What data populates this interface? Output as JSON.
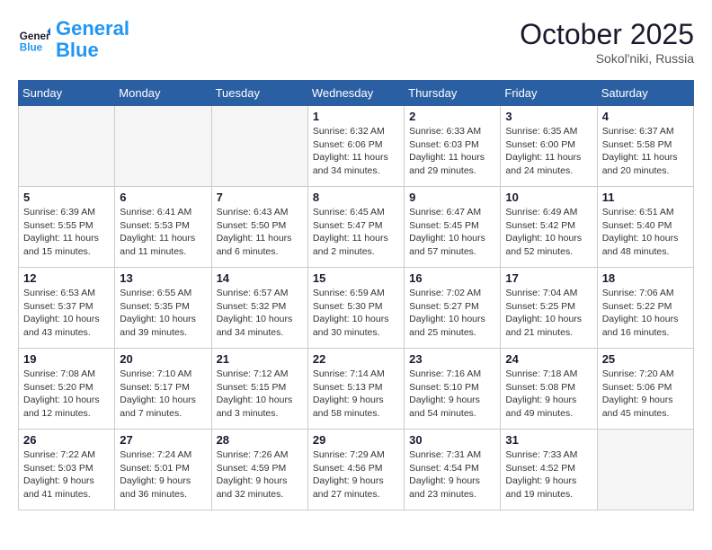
{
  "header": {
    "logo_line1": "General",
    "logo_line2": "Blue",
    "month": "October 2025",
    "location": "Sokol'niki, Russia"
  },
  "weekdays": [
    "Sunday",
    "Monday",
    "Tuesday",
    "Wednesday",
    "Thursday",
    "Friday",
    "Saturday"
  ],
  "weeks": [
    [
      {
        "day": "",
        "info": ""
      },
      {
        "day": "",
        "info": ""
      },
      {
        "day": "",
        "info": ""
      },
      {
        "day": "1",
        "info": "Sunrise: 6:32 AM\nSunset: 6:06 PM\nDaylight: 11 hours\nand 34 minutes."
      },
      {
        "day": "2",
        "info": "Sunrise: 6:33 AM\nSunset: 6:03 PM\nDaylight: 11 hours\nand 29 minutes."
      },
      {
        "day": "3",
        "info": "Sunrise: 6:35 AM\nSunset: 6:00 PM\nDaylight: 11 hours\nand 24 minutes."
      },
      {
        "day": "4",
        "info": "Sunrise: 6:37 AM\nSunset: 5:58 PM\nDaylight: 11 hours\nand 20 minutes."
      }
    ],
    [
      {
        "day": "5",
        "info": "Sunrise: 6:39 AM\nSunset: 5:55 PM\nDaylight: 11 hours\nand 15 minutes."
      },
      {
        "day": "6",
        "info": "Sunrise: 6:41 AM\nSunset: 5:53 PM\nDaylight: 11 hours\nand 11 minutes."
      },
      {
        "day": "7",
        "info": "Sunrise: 6:43 AM\nSunset: 5:50 PM\nDaylight: 11 hours\nand 6 minutes."
      },
      {
        "day": "8",
        "info": "Sunrise: 6:45 AM\nSunset: 5:47 PM\nDaylight: 11 hours\nand 2 minutes."
      },
      {
        "day": "9",
        "info": "Sunrise: 6:47 AM\nSunset: 5:45 PM\nDaylight: 10 hours\nand 57 minutes."
      },
      {
        "day": "10",
        "info": "Sunrise: 6:49 AM\nSunset: 5:42 PM\nDaylight: 10 hours\nand 52 minutes."
      },
      {
        "day": "11",
        "info": "Sunrise: 6:51 AM\nSunset: 5:40 PM\nDaylight: 10 hours\nand 48 minutes."
      }
    ],
    [
      {
        "day": "12",
        "info": "Sunrise: 6:53 AM\nSunset: 5:37 PM\nDaylight: 10 hours\nand 43 minutes."
      },
      {
        "day": "13",
        "info": "Sunrise: 6:55 AM\nSunset: 5:35 PM\nDaylight: 10 hours\nand 39 minutes."
      },
      {
        "day": "14",
        "info": "Sunrise: 6:57 AM\nSunset: 5:32 PM\nDaylight: 10 hours\nand 34 minutes."
      },
      {
        "day": "15",
        "info": "Sunrise: 6:59 AM\nSunset: 5:30 PM\nDaylight: 10 hours\nand 30 minutes."
      },
      {
        "day": "16",
        "info": "Sunrise: 7:02 AM\nSunset: 5:27 PM\nDaylight: 10 hours\nand 25 minutes."
      },
      {
        "day": "17",
        "info": "Sunrise: 7:04 AM\nSunset: 5:25 PM\nDaylight: 10 hours\nand 21 minutes."
      },
      {
        "day": "18",
        "info": "Sunrise: 7:06 AM\nSunset: 5:22 PM\nDaylight: 10 hours\nand 16 minutes."
      }
    ],
    [
      {
        "day": "19",
        "info": "Sunrise: 7:08 AM\nSunset: 5:20 PM\nDaylight: 10 hours\nand 12 minutes."
      },
      {
        "day": "20",
        "info": "Sunrise: 7:10 AM\nSunset: 5:17 PM\nDaylight: 10 hours\nand 7 minutes."
      },
      {
        "day": "21",
        "info": "Sunrise: 7:12 AM\nSunset: 5:15 PM\nDaylight: 10 hours\nand 3 minutes."
      },
      {
        "day": "22",
        "info": "Sunrise: 7:14 AM\nSunset: 5:13 PM\nDaylight: 9 hours\nand 58 minutes."
      },
      {
        "day": "23",
        "info": "Sunrise: 7:16 AM\nSunset: 5:10 PM\nDaylight: 9 hours\nand 54 minutes."
      },
      {
        "day": "24",
        "info": "Sunrise: 7:18 AM\nSunset: 5:08 PM\nDaylight: 9 hours\nand 49 minutes."
      },
      {
        "day": "25",
        "info": "Sunrise: 7:20 AM\nSunset: 5:06 PM\nDaylight: 9 hours\nand 45 minutes."
      }
    ],
    [
      {
        "day": "26",
        "info": "Sunrise: 7:22 AM\nSunset: 5:03 PM\nDaylight: 9 hours\nand 41 minutes."
      },
      {
        "day": "27",
        "info": "Sunrise: 7:24 AM\nSunset: 5:01 PM\nDaylight: 9 hours\nand 36 minutes."
      },
      {
        "day": "28",
        "info": "Sunrise: 7:26 AM\nSunset: 4:59 PM\nDaylight: 9 hours\nand 32 minutes."
      },
      {
        "day": "29",
        "info": "Sunrise: 7:29 AM\nSunset: 4:56 PM\nDaylight: 9 hours\nand 27 minutes."
      },
      {
        "day": "30",
        "info": "Sunrise: 7:31 AM\nSunset: 4:54 PM\nDaylight: 9 hours\nand 23 minutes."
      },
      {
        "day": "31",
        "info": "Sunrise: 7:33 AM\nSunset: 4:52 PM\nDaylight: 9 hours\nand 19 minutes."
      },
      {
        "day": "",
        "info": ""
      }
    ]
  ]
}
